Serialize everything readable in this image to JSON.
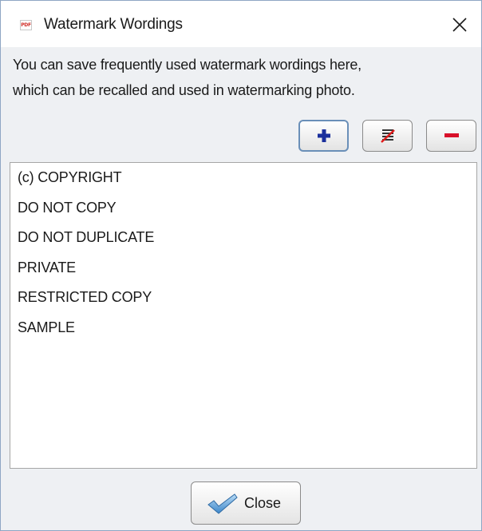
{
  "window": {
    "title": "Watermark Wordings",
    "app_icon_text": "PDF",
    "close_icon": "close-icon"
  },
  "description": {
    "line1": "You can save frequently used watermark wordings here,",
    "line2": "which can be recalled and used in watermarking photo."
  },
  "toolbar": {
    "add_icon": "plus-icon",
    "edit_icon": "edit-icon",
    "remove_icon": "minus-icon"
  },
  "wordings": [
    "(c) COPYRIGHT",
    "DO NOT COPY",
    "DO NOT DUPLICATE",
    "PRIVATE",
    "RESTRICTED COPY",
    "SAMPLE"
  ],
  "footer": {
    "close_label": "Close",
    "close_icon": "checkmark-icon"
  },
  "colors": {
    "add_icon": "#1a2f9c",
    "remove_icon": "#d8102a",
    "edit_strike": "#e01a1a",
    "check_icon": "#4a8fd0"
  }
}
